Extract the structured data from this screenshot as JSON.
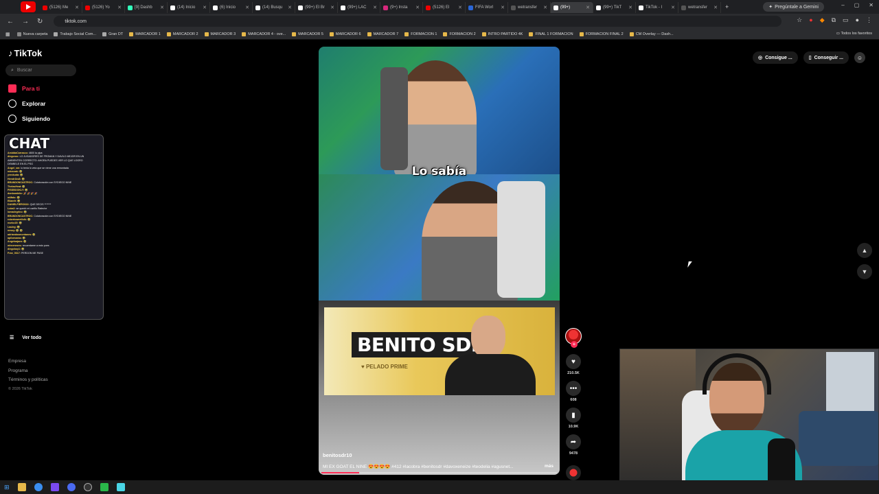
{
  "browser": {
    "tabs": [
      {
        "label": "(5126) Me",
        "color": "#e00"
      },
      {
        "label": "(5126) Yo",
        "color": "#e00"
      },
      {
        "label": "[9] Dashb",
        "color": "#3fb"
      },
      {
        "label": "(14) Inicio",
        "color": "#fff"
      },
      {
        "label": "(6) Inicio",
        "color": "#fff"
      },
      {
        "label": "(14) Busqu",
        "color": "#fff"
      },
      {
        "label": "(99+) El Br",
        "color": "#fff"
      },
      {
        "label": "(99+) LAC",
        "color": "#fff"
      },
      {
        "label": "(9+) Insta",
        "color": "#d6287c"
      },
      {
        "label": "(5126) El",
        "color": "#e00"
      },
      {
        "label": "FIFA Worl",
        "color": "#2a66d6"
      },
      {
        "label": "wetransfer",
        "color": "#555"
      },
      {
        "label": "(99+)",
        "color": "#fff"
      },
      {
        "label": "(99+) TikT",
        "color": "#fff"
      },
      {
        "label": "TikTok - I",
        "color": "#fff"
      },
      {
        "label": "wetransfer",
        "color": "#555"
      }
    ],
    "gemini_label": "Pregúntale a Gemini",
    "url": "tiktok.com",
    "bookmarks": [
      "Nueva carpeta",
      "Trabajo Social Com...",
      "Gran DT",
      "MARCADOR 1",
      "MARCADOR 2",
      "MARCADOR 3",
      "MARCADOR 4 - ove...",
      "MARCADOR 5",
      "MARCADOR 6",
      "MARCADOR 7",
      "FORMACION 1",
      "FORMACION 2",
      "INTRO PARTIDO 4K",
      "FINAL 1 FORMACION",
      "FORMACION FINAL 2",
      "CM Overlay — Dash..."
    ],
    "all_bookmarks": "Todos los favoritos"
  },
  "sidebar": {
    "logo": "TikTok",
    "search_placeholder": "Buscar",
    "nav": [
      {
        "label": "Para ti",
        "color": "#fe2c55"
      },
      {
        "label": "Explorar",
        "color": "#fff"
      },
      {
        "label": "Siguiendo",
        "color": "#fff"
      }
    ],
    "see_all": "Ver todo",
    "footer": [
      "Empresa",
      "Programa",
      "Términos y políticas"
    ],
    "copyright": "© 2026 TikTok"
  },
  "chat": {
    "title": "CHAT",
    "lines": [
      {
        "user": "AmiddaCarrasco:",
        "msg": "4600 la pipa"
      },
      {
        "user": "diegoroo:",
        "msg": "LO JUGADORES DE FROMAN Y DAVILO MEJOR EN UN"
      },
      {
        "user": "",
        "msg": "AMBIENTEN CORRECTO: AHORA PUEDES VER LO QUE LOGRO"
      },
      {
        "user": "",
        "msg": "DEMBELE EN EL PSG"
      },
      {
        "user": "Angel_sm:",
        "msg": "lo tenia lo veia que se viene una remontada"
      },
      {
        "user": "ndosnak:",
        "msg": "🤣"
      },
      {
        "user": "yvrokuda:",
        "msg": "🤣"
      },
      {
        "user": "Hendr1ks8:",
        "msg": "🤣"
      },
      {
        "user": "BRANDONCASTROC:",
        "msg": "Colaboración con SYDIEGO NINE"
      },
      {
        "user": "ThelasHeat:",
        "msg": "🤣"
      },
      {
        "user": "PISSBOOKLY:",
        "msg": "🤣"
      },
      {
        "user": "donbombito:",
        "msg": "🎉 🎉 🎉 🎉"
      },
      {
        "user": "mMalu:",
        "msg": "🤣"
      },
      {
        "user": "Eliamfr:",
        "msg": "🤣"
      },
      {
        "user": "DANIELPIERO022:",
        "msg": "QUE DECIS *******"
      },
      {
        "user": "Luka2:",
        "msg": "se quedó mi cariño Rafeche"
      },
      {
        "user": "lomadegrino:",
        "msg": "🤣"
      },
      {
        "user": "BRANDONCASTROC:",
        "msg": "Colaboración con SYDIEGO NINE"
      },
      {
        "user": "robertoweelfolk:",
        "msg": "🤣"
      },
      {
        "user": "nseko15:",
        "msg": "🤣"
      },
      {
        "user": "Lauleg:",
        "msg": "🤣"
      },
      {
        "user": "nessy:",
        "msg": "🤣 🤣"
      },
      {
        "user": "adriandosmontanes:",
        "msg": "🤣"
      },
      {
        "user": "apilomaeas:",
        "msg": "🤣"
      },
      {
        "user": "Angeloajacs:",
        "msg": "🤣"
      },
      {
        "user": "mhnenezes:",
        "msg": "recuerdame a esto pues"
      },
      {
        "user": "diegoboy1:",
        "msg": "🤣"
      },
      {
        "user": "Fran_0617:",
        "msg": "PERDON ME PASE"
      }
    ]
  },
  "video": {
    "caption": "Lo sabía",
    "banner_name": "BENITO SDR",
    "banner_sub": "♥ PELADO PRIME",
    "author": "benitosdr10",
    "description": "MI EX GOAT EL NINE 😍😍😍😍 #412 #lacobra #benitosdr #davoxeneize #teodelia #agusnet...",
    "more": "más",
    "progress": 0.16
  },
  "actions": {
    "likes": "210.5K",
    "comments": "608",
    "saves": "10.9K",
    "shares": "9478"
  },
  "topright": {
    "btn1": "Consigue ...",
    "btn2": "Conseguir ..."
  }
}
